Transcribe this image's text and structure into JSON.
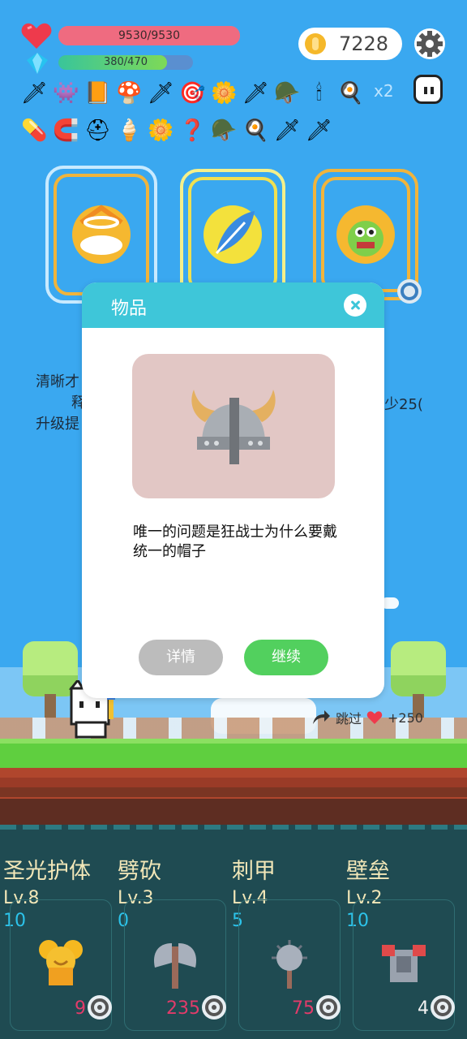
{
  "hud": {
    "hp_text": "9530/9530",
    "hp_fraction": 1.0,
    "mp_text": "380/470",
    "mp_fraction": 0.81,
    "coins": "7228",
    "multiplier": "x2"
  },
  "items_row1": [
    "🗡",
    "👾",
    "📙",
    "🍄",
    "🗡",
    "🎯",
    "🌼",
    "🗡",
    "🪖",
    "🕯",
    "🍳"
  ],
  "items_row2": [
    "💊",
    "🧲",
    "⛑",
    "🍦",
    "🌼",
    "❓",
    "🪖",
    "🍳",
    "🗡",
    "🗡"
  ],
  "bg_text": {
    "left1": "清晰才",
    "left2": "释",
    "left3": "升级提",
    "right": "少25("
  },
  "modal": {
    "title": "物品",
    "description": "唯一的问题是狂战士为什么要戴统一的帽子",
    "detail_label": "详情",
    "continue_label": "继续"
  },
  "skip": {
    "label": "跳过",
    "bonus": "+250"
  },
  "skills": [
    {
      "name": "圣光护体",
      "level": "Lv.8",
      "cost": "10",
      "count": "9"
    },
    {
      "name": "劈砍",
      "level": "Lv.3",
      "cost": "0",
      "count": "235"
    },
    {
      "name": "刺甲",
      "level": "Lv.4",
      "cost": "5",
      "count": "75"
    },
    {
      "name": "壁垒",
      "level": "Lv.2",
      "cost": "10",
      "count": "4"
    }
  ],
  "colors": {
    "background": "#3aa8f0",
    "modal_header": "#3ec6d9",
    "continue_button": "#52d05e",
    "detail_button": "#bcbcbc",
    "skill_count": "#e23b6a"
  },
  "icons": {
    "hp": "heart-icon",
    "mp": "gem-icon",
    "coin": "coin-icon",
    "settings": "gear-icon",
    "item": "viking-helmet-icon"
  }
}
